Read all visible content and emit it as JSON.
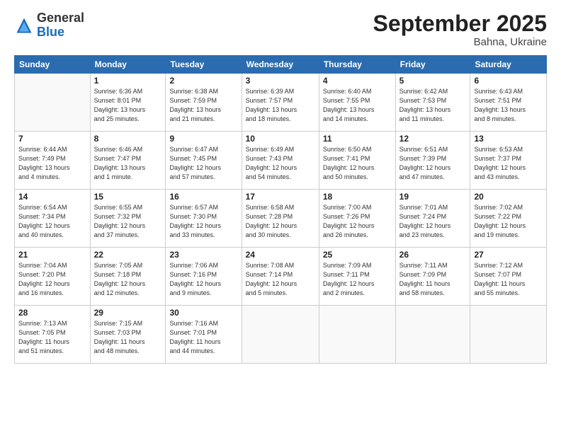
{
  "header": {
    "logo_general": "General",
    "logo_blue": "Blue",
    "month_title": "September 2025",
    "subtitle": "Bahna, Ukraine"
  },
  "weekdays": [
    "Sunday",
    "Monday",
    "Tuesday",
    "Wednesday",
    "Thursday",
    "Friday",
    "Saturday"
  ],
  "weeks": [
    [
      {
        "day": "",
        "info": ""
      },
      {
        "day": "1",
        "info": "Sunrise: 6:36 AM\nSunset: 8:01 PM\nDaylight: 13 hours\nand 25 minutes."
      },
      {
        "day": "2",
        "info": "Sunrise: 6:38 AM\nSunset: 7:59 PM\nDaylight: 13 hours\nand 21 minutes."
      },
      {
        "day": "3",
        "info": "Sunrise: 6:39 AM\nSunset: 7:57 PM\nDaylight: 13 hours\nand 18 minutes."
      },
      {
        "day": "4",
        "info": "Sunrise: 6:40 AM\nSunset: 7:55 PM\nDaylight: 13 hours\nand 14 minutes."
      },
      {
        "day": "5",
        "info": "Sunrise: 6:42 AM\nSunset: 7:53 PM\nDaylight: 13 hours\nand 11 minutes."
      },
      {
        "day": "6",
        "info": "Sunrise: 6:43 AM\nSunset: 7:51 PM\nDaylight: 13 hours\nand 8 minutes."
      }
    ],
    [
      {
        "day": "7",
        "info": "Sunrise: 6:44 AM\nSunset: 7:49 PM\nDaylight: 13 hours\nand 4 minutes."
      },
      {
        "day": "8",
        "info": "Sunrise: 6:46 AM\nSunset: 7:47 PM\nDaylight: 13 hours\nand 1 minute."
      },
      {
        "day": "9",
        "info": "Sunrise: 6:47 AM\nSunset: 7:45 PM\nDaylight: 12 hours\nand 57 minutes."
      },
      {
        "day": "10",
        "info": "Sunrise: 6:49 AM\nSunset: 7:43 PM\nDaylight: 12 hours\nand 54 minutes."
      },
      {
        "day": "11",
        "info": "Sunrise: 6:50 AM\nSunset: 7:41 PM\nDaylight: 12 hours\nand 50 minutes."
      },
      {
        "day": "12",
        "info": "Sunrise: 6:51 AM\nSunset: 7:39 PM\nDaylight: 12 hours\nand 47 minutes."
      },
      {
        "day": "13",
        "info": "Sunrise: 6:53 AM\nSunset: 7:37 PM\nDaylight: 12 hours\nand 43 minutes."
      }
    ],
    [
      {
        "day": "14",
        "info": "Sunrise: 6:54 AM\nSunset: 7:34 PM\nDaylight: 12 hours\nand 40 minutes."
      },
      {
        "day": "15",
        "info": "Sunrise: 6:55 AM\nSunset: 7:32 PM\nDaylight: 12 hours\nand 37 minutes."
      },
      {
        "day": "16",
        "info": "Sunrise: 6:57 AM\nSunset: 7:30 PM\nDaylight: 12 hours\nand 33 minutes."
      },
      {
        "day": "17",
        "info": "Sunrise: 6:58 AM\nSunset: 7:28 PM\nDaylight: 12 hours\nand 30 minutes."
      },
      {
        "day": "18",
        "info": "Sunrise: 7:00 AM\nSunset: 7:26 PM\nDaylight: 12 hours\nand 26 minutes."
      },
      {
        "day": "19",
        "info": "Sunrise: 7:01 AM\nSunset: 7:24 PM\nDaylight: 12 hours\nand 23 minutes."
      },
      {
        "day": "20",
        "info": "Sunrise: 7:02 AM\nSunset: 7:22 PM\nDaylight: 12 hours\nand 19 minutes."
      }
    ],
    [
      {
        "day": "21",
        "info": "Sunrise: 7:04 AM\nSunset: 7:20 PM\nDaylight: 12 hours\nand 16 minutes."
      },
      {
        "day": "22",
        "info": "Sunrise: 7:05 AM\nSunset: 7:18 PM\nDaylight: 12 hours\nand 12 minutes."
      },
      {
        "day": "23",
        "info": "Sunrise: 7:06 AM\nSunset: 7:16 PM\nDaylight: 12 hours\nand 9 minutes."
      },
      {
        "day": "24",
        "info": "Sunrise: 7:08 AM\nSunset: 7:14 PM\nDaylight: 12 hours\nand 5 minutes."
      },
      {
        "day": "25",
        "info": "Sunrise: 7:09 AM\nSunset: 7:11 PM\nDaylight: 12 hours\nand 2 minutes."
      },
      {
        "day": "26",
        "info": "Sunrise: 7:11 AM\nSunset: 7:09 PM\nDaylight: 11 hours\nand 58 minutes."
      },
      {
        "day": "27",
        "info": "Sunrise: 7:12 AM\nSunset: 7:07 PM\nDaylight: 11 hours\nand 55 minutes."
      }
    ],
    [
      {
        "day": "28",
        "info": "Sunrise: 7:13 AM\nSunset: 7:05 PM\nDaylight: 11 hours\nand 51 minutes."
      },
      {
        "day": "29",
        "info": "Sunrise: 7:15 AM\nSunset: 7:03 PM\nDaylight: 11 hours\nand 48 minutes."
      },
      {
        "day": "30",
        "info": "Sunrise: 7:16 AM\nSunset: 7:01 PM\nDaylight: 11 hours\nand 44 minutes."
      },
      {
        "day": "",
        "info": ""
      },
      {
        "day": "",
        "info": ""
      },
      {
        "day": "",
        "info": ""
      },
      {
        "day": "",
        "info": ""
      }
    ]
  ]
}
